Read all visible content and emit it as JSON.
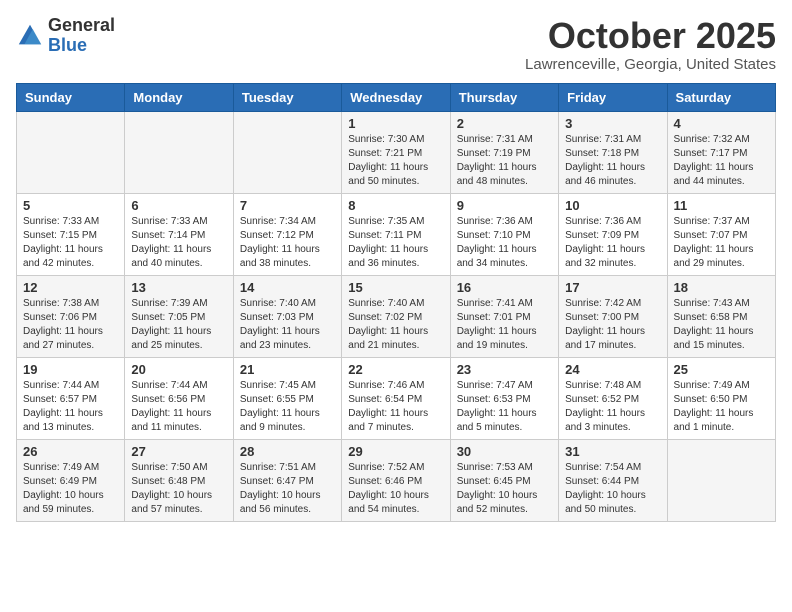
{
  "header": {
    "logo_general": "General",
    "logo_blue": "Blue",
    "month_title": "October 2025",
    "location": "Lawrenceville, Georgia, United States"
  },
  "days_of_week": [
    "Sunday",
    "Monday",
    "Tuesday",
    "Wednesday",
    "Thursday",
    "Friday",
    "Saturday"
  ],
  "weeks": [
    [
      {
        "day": "",
        "info": ""
      },
      {
        "day": "",
        "info": ""
      },
      {
        "day": "",
        "info": ""
      },
      {
        "day": "1",
        "info": "Sunrise: 7:30 AM\nSunset: 7:21 PM\nDaylight: 11 hours and 50 minutes."
      },
      {
        "day": "2",
        "info": "Sunrise: 7:31 AM\nSunset: 7:19 PM\nDaylight: 11 hours and 48 minutes."
      },
      {
        "day": "3",
        "info": "Sunrise: 7:31 AM\nSunset: 7:18 PM\nDaylight: 11 hours and 46 minutes."
      },
      {
        "day": "4",
        "info": "Sunrise: 7:32 AM\nSunset: 7:17 PM\nDaylight: 11 hours and 44 minutes."
      }
    ],
    [
      {
        "day": "5",
        "info": "Sunrise: 7:33 AM\nSunset: 7:15 PM\nDaylight: 11 hours and 42 minutes."
      },
      {
        "day": "6",
        "info": "Sunrise: 7:33 AM\nSunset: 7:14 PM\nDaylight: 11 hours and 40 minutes."
      },
      {
        "day": "7",
        "info": "Sunrise: 7:34 AM\nSunset: 7:12 PM\nDaylight: 11 hours and 38 minutes."
      },
      {
        "day": "8",
        "info": "Sunrise: 7:35 AM\nSunset: 7:11 PM\nDaylight: 11 hours and 36 minutes."
      },
      {
        "day": "9",
        "info": "Sunrise: 7:36 AM\nSunset: 7:10 PM\nDaylight: 11 hours and 34 minutes."
      },
      {
        "day": "10",
        "info": "Sunrise: 7:36 AM\nSunset: 7:09 PM\nDaylight: 11 hours and 32 minutes."
      },
      {
        "day": "11",
        "info": "Sunrise: 7:37 AM\nSunset: 7:07 PM\nDaylight: 11 hours and 29 minutes."
      }
    ],
    [
      {
        "day": "12",
        "info": "Sunrise: 7:38 AM\nSunset: 7:06 PM\nDaylight: 11 hours and 27 minutes."
      },
      {
        "day": "13",
        "info": "Sunrise: 7:39 AM\nSunset: 7:05 PM\nDaylight: 11 hours and 25 minutes."
      },
      {
        "day": "14",
        "info": "Sunrise: 7:40 AM\nSunset: 7:03 PM\nDaylight: 11 hours and 23 minutes."
      },
      {
        "day": "15",
        "info": "Sunrise: 7:40 AM\nSunset: 7:02 PM\nDaylight: 11 hours and 21 minutes."
      },
      {
        "day": "16",
        "info": "Sunrise: 7:41 AM\nSunset: 7:01 PM\nDaylight: 11 hours and 19 minutes."
      },
      {
        "day": "17",
        "info": "Sunrise: 7:42 AM\nSunset: 7:00 PM\nDaylight: 11 hours and 17 minutes."
      },
      {
        "day": "18",
        "info": "Sunrise: 7:43 AM\nSunset: 6:58 PM\nDaylight: 11 hours and 15 minutes."
      }
    ],
    [
      {
        "day": "19",
        "info": "Sunrise: 7:44 AM\nSunset: 6:57 PM\nDaylight: 11 hours and 13 minutes."
      },
      {
        "day": "20",
        "info": "Sunrise: 7:44 AM\nSunset: 6:56 PM\nDaylight: 11 hours and 11 minutes."
      },
      {
        "day": "21",
        "info": "Sunrise: 7:45 AM\nSunset: 6:55 PM\nDaylight: 11 hours and 9 minutes."
      },
      {
        "day": "22",
        "info": "Sunrise: 7:46 AM\nSunset: 6:54 PM\nDaylight: 11 hours and 7 minutes."
      },
      {
        "day": "23",
        "info": "Sunrise: 7:47 AM\nSunset: 6:53 PM\nDaylight: 11 hours and 5 minutes."
      },
      {
        "day": "24",
        "info": "Sunrise: 7:48 AM\nSunset: 6:52 PM\nDaylight: 11 hours and 3 minutes."
      },
      {
        "day": "25",
        "info": "Sunrise: 7:49 AM\nSunset: 6:50 PM\nDaylight: 11 hours and 1 minute."
      }
    ],
    [
      {
        "day": "26",
        "info": "Sunrise: 7:49 AM\nSunset: 6:49 PM\nDaylight: 10 hours and 59 minutes."
      },
      {
        "day": "27",
        "info": "Sunrise: 7:50 AM\nSunset: 6:48 PM\nDaylight: 10 hours and 57 minutes."
      },
      {
        "day": "28",
        "info": "Sunrise: 7:51 AM\nSunset: 6:47 PM\nDaylight: 10 hours and 56 minutes."
      },
      {
        "day": "29",
        "info": "Sunrise: 7:52 AM\nSunset: 6:46 PM\nDaylight: 10 hours and 54 minutes."
      },
      {
        "day": "30",
        "info": "Sunrise: 7:53 AM\nSunset: 6:45 PM\nDaylight: 10 hours and 52 minutes."
      },
      {
        "day": "31",
        "info": "Sunrise: 7:54 AM\nSunset: 6:44 PM\nDaylight: 10 hours and 50 minutes."
      },
      {
        "day": "",
        "info": ""
      }
    ]
  ]
}
